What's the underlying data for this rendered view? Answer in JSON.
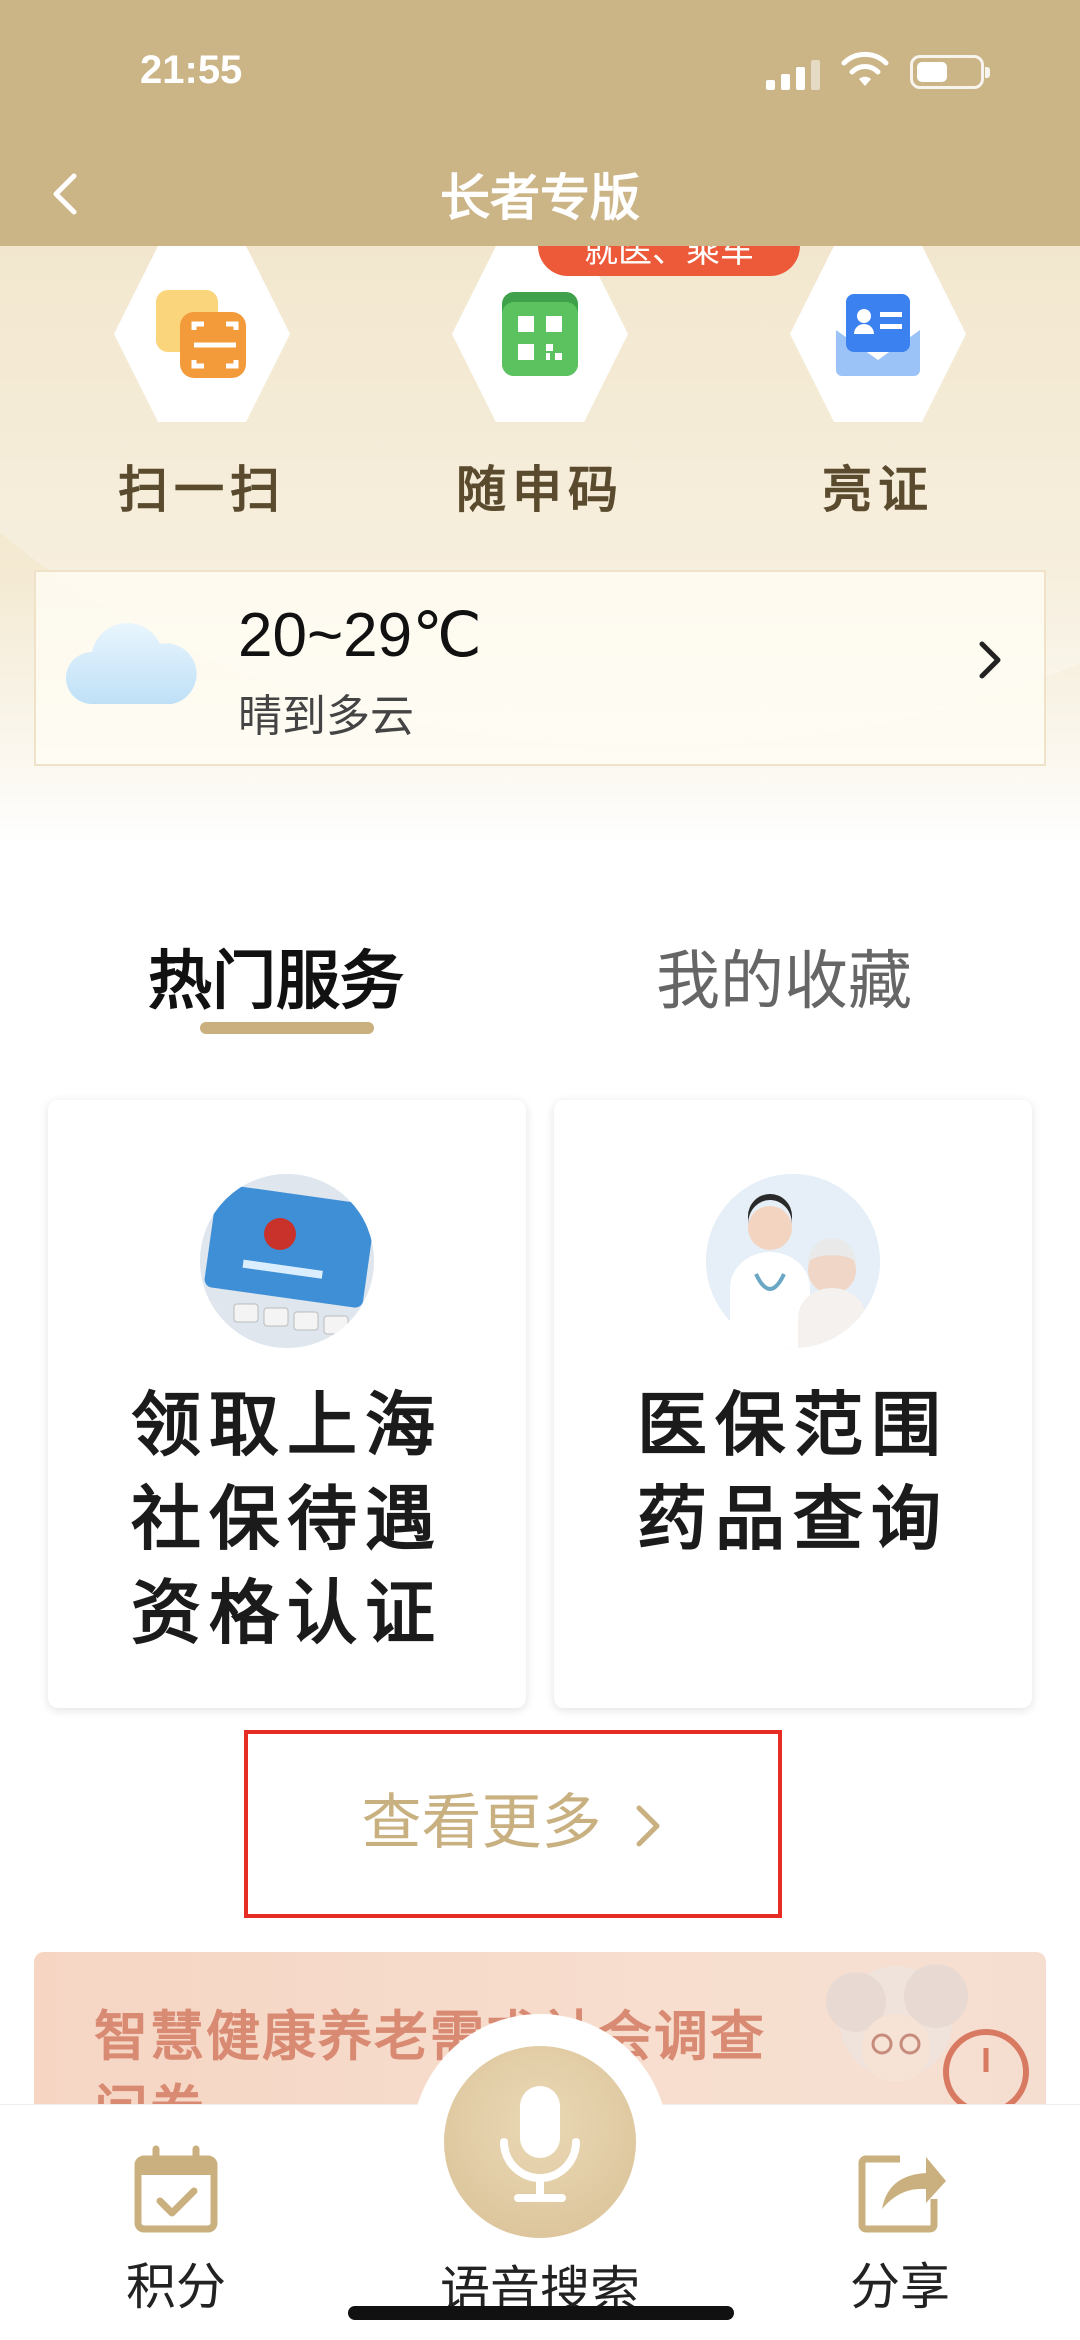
{
  "status_bar": {
    "time": "21:55"
  },
  "nav": {
    "title": "长者专版"
  },
  "promo_tag": "就医、乘车",
  "quick_actions": [
    {
      "label": "扫一扫",
      "icon": "scan-icon"
    },
    {
      "label": "随申码",
      "icon": "qr-code-icon"
    },
    {
      "label": "亮证",
      "icon": "id-card-icon"
    }
  ],
  "weather": {
    "temperature": "20~29℃",
    "condition": "晴到多云",
    "icon": "cloud-icon"
  },
  "tabs": [
    {
      "label": "热门服务",
      "active": true
    },
    {
      "label": "我的收藏",
      "active": false
    }
  ],
  "service_cards": [
    {
      "lines": [
        "领取上海",
        "社保待遇",
        "资格认证"
      ],
      "icon": "social-security-card-image"
    },
    {
      "lines": [
        "医保范围",
        "药品查询"
      ],
      "icon": "doctor-patient-image"
    }
  ],
  "more": {
    "label": "查看更多"
  },
  "banner": {
    "text": "智慧健康养老需求社会调查问卷"
  },
  "bottom_nav": {
    "points": "积分",
    "voice_search": "语音搜索",
    "share": "分享"
  },
  "colors": {
    "brand_gold": "#cbb587",
    "accent_red": "#ec5a3a",
    "highlight_box": "#e52d26",
    "more_text": "#c8b081"
  }
}
